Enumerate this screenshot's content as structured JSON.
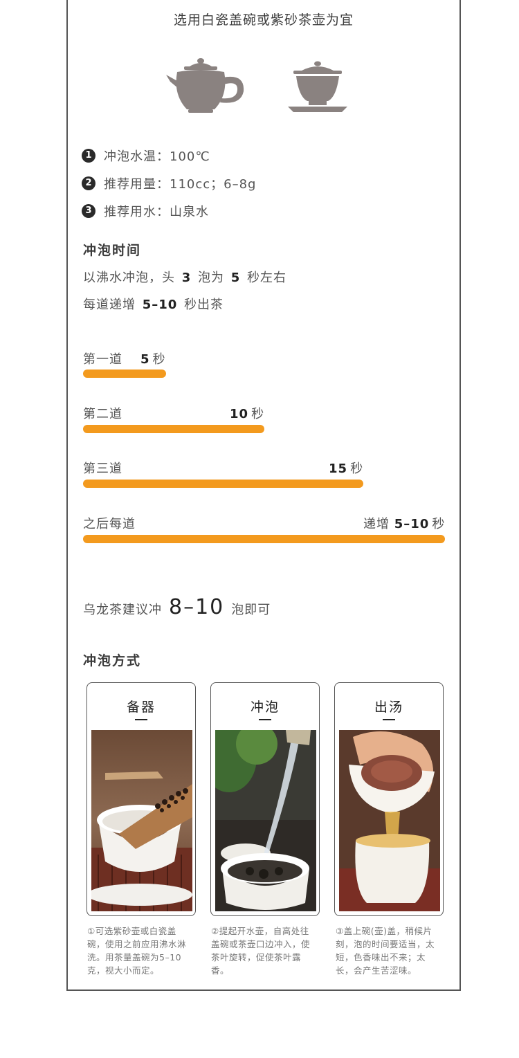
{
  "title": "选用白瓷盖碗或紫砂茶壶为宜",
  "icons": [
    "teapot-icon",
    "gaiwan-icon"
  ],
  "params": [
    {
      "num": "1",
      "text": "冲泡水温：100℃"
    },
    {
      "num": "2",
      "text": "推荐用量：110cc；6–8g"
    },
    {
      "num": "3",
      "text": "推荐用水：山泉水"
    }
  ],
  "brew_time": {
    "title": "冲泡时间",
    "line1": {
      "a": "以沸水冲泡，头",
      "n1": "3",
      "b": "泡为",
      "n2": "5",
      "c": "秒左右"
    },
    "line2": {
      "a": "每道递增",
      "n": "5–10",
      "b": "秒出茶"
    }
  },
  "steps": [
    {
      "label": "第一道",
      "value": "5",
      "unit": "秒",
      "prefix": "",
      "fraction": 0.23
    },
    {
      "label": "第二道",
      "value": "10",
      "unit": "秒",
      "prefix": "",
      "fraction": 0.5
    },
    {
      "label": "第三道",
      "value": "15",
      "unit": "秒",
      "prefix": "",
      "fraction": 0.775
    },
    {
      "label": "之后每道",
      "value": "5–10",
      "unit": "秒",
      "prefix": "递增",
      "fraction": 1.0
    }
  ],
  "infusions": {
    "a": "乌龙茶建议冲",
    "n": "8–10",
    "b": "泡即可"
  },
  "method": {
    "title": "冲泡方式",
    "cards": [
      {
        "title": "备器",
        "caption": "①可选紫砂壶或白瓷盖碗，使用之前应用沸水淋洗。用茶量盖碗为5–10克，视大小而定。"
      },
      {
        "title": "冲泡",
        "caption": "②提起开水壶，自高处往盖碗或茶壶口边冲入，使茶叶旋转，促使茶叶露香。"
      },
      {
        "title": "出汤",
        "caption": "③盖上碗(壶)盖，稍候片刻，泡的时间要适当，太短，色香味出不来；太长，会产生苦涩味。"
      }
    ]
  },
  "colors": {
    "bar": "#f39a1e",
    "icon": "#8a8280",
    "frame": "#555555"
  }
}
